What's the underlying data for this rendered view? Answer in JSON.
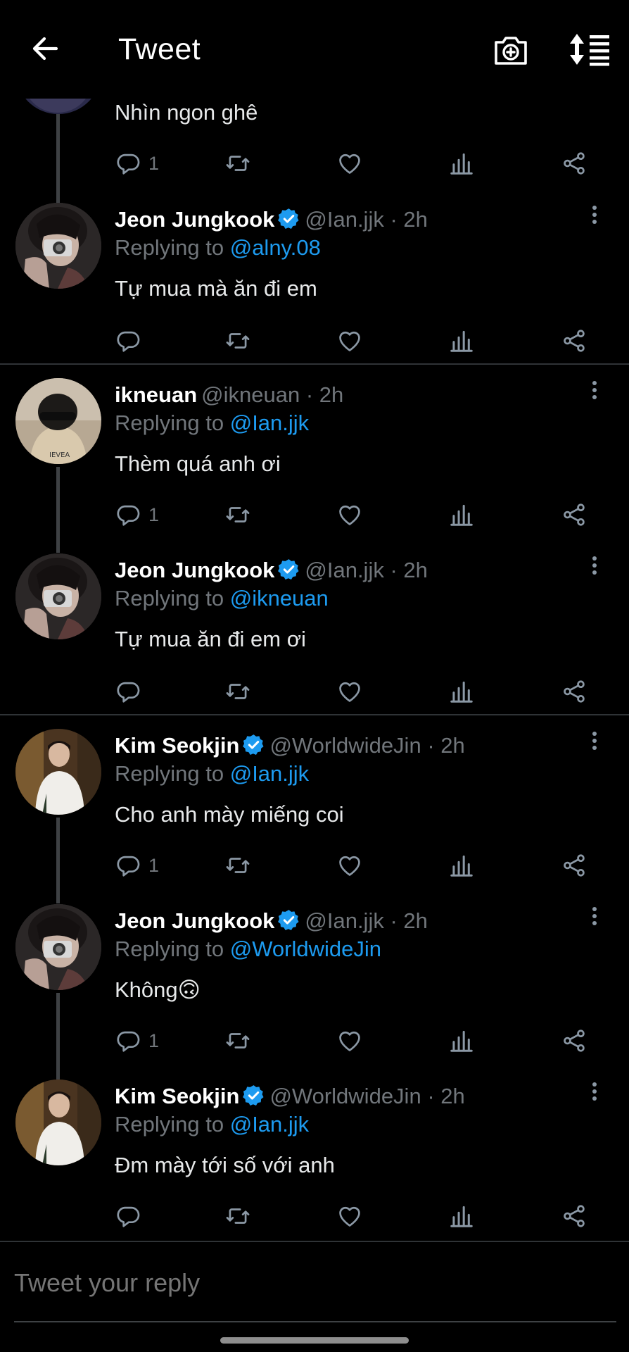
{
  "header": {
    "title": "Tweet",
    "back_icon": "arrow-left-icon",
    "camera_icon": "camera-plus-icon",
    "sort_icon": "sort-icon"
  },
  "colors": {
    "background": "#000000",
    "link": "#1d9bf0",
    "muted": "#71767b",
    "verified": "#1d9bf0"
  },
  "top_tweet": {
    "text": "Nhìn ngon ghê",
    "reply_count": "1"
  },
  "tweets": [
    {
      "name": "Jeon Jungkook",
      "verified": true,
      "handle": "@Ian.jjk",
      "time": "· 2h",
      "replying_label": "Replying to",
      "replying_to": "@alny.08",
      "text": "Tự mua mà ăn đi em",
      "reply_count": ""
    },
    {
      "name": "ikneuan",
      "verified": false,
      "handle": "@ikneuan",
      "time": "· 2h",
      "replying_label": "Replying to",
      "replying_to": "@Ian.jjk",
      "text": "Thèm quá anh ơi",
      "reply_count": "1"
    },
    {
      "name": "Jeon Jungkook",
      "verified": true,
      "handle": "@Ian.jjk",
      "time": "· 2h",
      "replying_label": "Replying to",
      "replying_to": "@ikneuan",
      "text": "Tự mua ăn đi em ơi",
      "reply_count": ""
    },
    {
      "name": "Kim Seokjin",
      "verified": true,
      "handle": "@WorldwideJin",
      "time": "· 2h",
      "replying_label": "Replying to",
      "replying_to": "@Ian.jjk",
      "text": "Cho anh mày miếng coi",
      "reply_count": "1"
    },
    {
      "name": "Jeon Jungkook",
      "verified": true,
      "handle": "@Ian.jjk",
      "time": "· 2h",
      "replying_label": "Replying to",
      "replying_to": "@WorldwideJin",
      "text": "Không🙃",
      "reply_count": "1"
    },
    {
      "name": "Kim Seokjin",
      "verified": true,
      "handle": "@WorldwideJin",
      "time": "· 2h",
      "replying_label": "Replying to",
      "replying_to": "@Ian.jjk",
      "text": "Đm mày tới số với anh",
      "reply_count": ""
    }
  ],
  "composer": {
    "placeholder": "Tweet your reply"
  }
}
